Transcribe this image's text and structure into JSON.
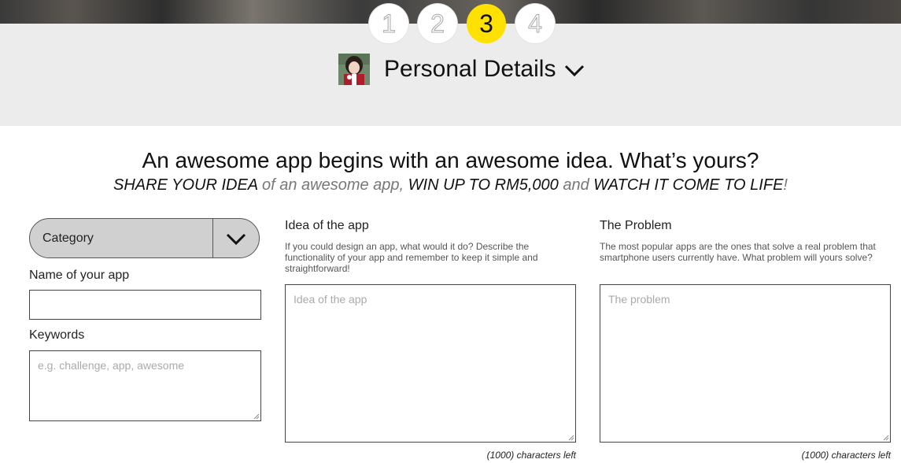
{
  "stepper": {
    "steps": [
      "1",
      "2",
      "3",
      "4"
    ],
    "active_step": "3"
  },
  "section": {
    "title": "Personal Details"
  },
  "intro": {
    "headline": "An awesome app begins with an awesome idea. What’s yours?",
    "tagline": {
      "part1": "SHARE YOUR IDEA",
      "part2": " of an awesome app, ",
      "part3": "WIN UP TO RM5,000",
      "part4": " and ",
      "part5": "WATCH IT COME TO LIFE",
      "part6": "!"
    }
  },
  "form": {
    "category": {
      "label": "Category"
    },
    "app_name": {
      "label": "Name of your app",
      "value": ""
    },
    "keywords": {
      "label": "Keywords",
      "placeholder": "e.g. challenge, app, awesome"
    },
    "idea": {
      "label": "Idea of the app",
      "description": "If you could design an app, what would it do? Describe the functionality of your app and remember to keep it simple and straightforward!",
      "placeholder": "Idea of the app",
      "counter": "(1000) characters left"
    },
    "problem": {
      "label": "The Problem",
      "description": "The most popular apps are the ones that solve a real problem that smartphone users currently have. What problem will yours solve?",
      "placeholder": "The problem",
      "counter": "(1000) characters left"
    }
  },
  "colors": {
    "active_step": "#ffe100",
    "header_bg": "#ececec",
    "category_bg": "#d0d0d0"
  },
  "icons": {
    "section_toggle": "chevron-down-icon",
    "category_toggle": "chevron-down-icon",
    "avatar": "user-avatar"
  }
}
